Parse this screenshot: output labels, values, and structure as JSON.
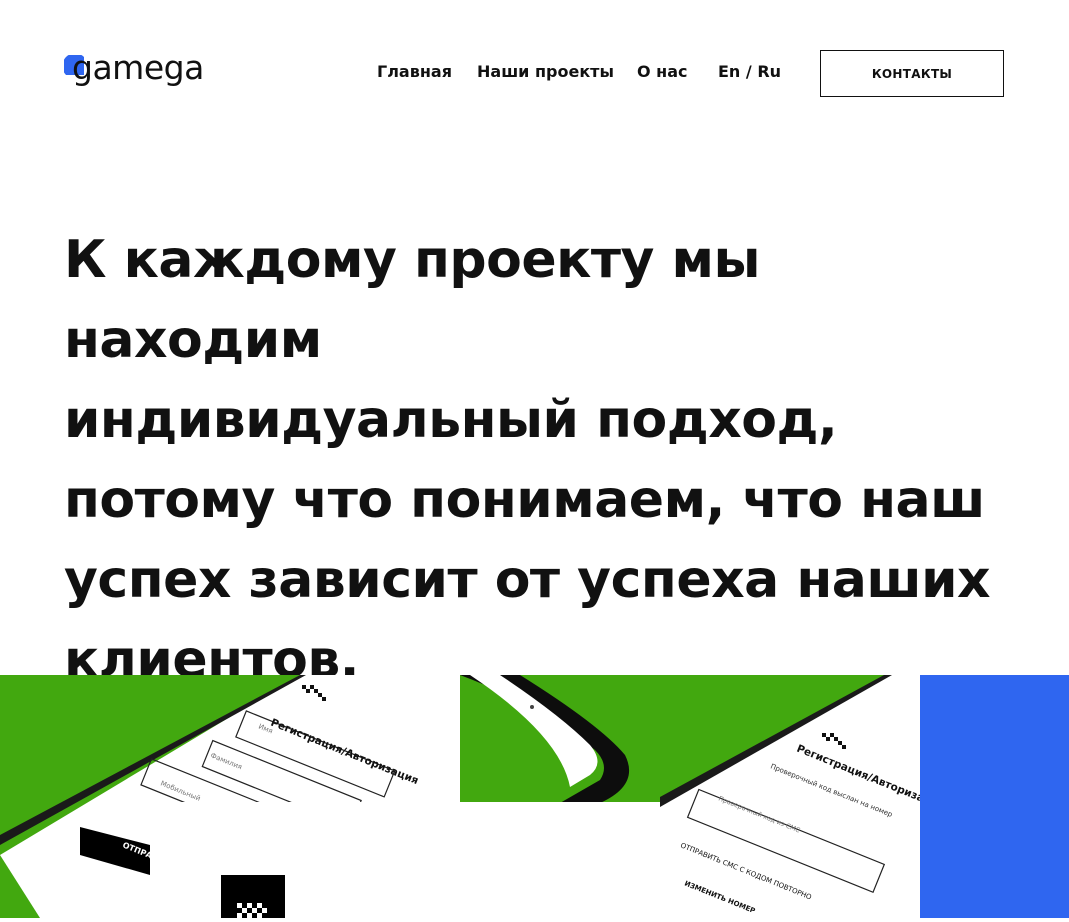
{
  "header": {
    "logo_text": "gamega",
    "nav": [
      {
        "label": "Главная"
      },
      {
        "label": "Наши проекты"
      },
      {
        "label": "О нас"
      }
    ],
    "lang_en": "En",
    "lang_sep": "/",
    "lang_ru": "Ru",
    "contacts_label": "КОНТАКТЫ"
  },
  "hero": {
    "lines": [
      "К каждому проекту мы находим",
      "индивидуальный подход,",
      "потому что понимаем, что наш",
      "успех зависит от успеха наших",
      "клиентов."
    ]
  },
  "gallery": {
    "left_screen": {
      "title": "Регистрация/Авторизация",
      "field_1": "Имя",
      "field_2": "Фамилия",
      "field_3": "Мобильный",
      "button": "ОТПРАВИТЬ"
    },
    "right_screen": {
      "title": "Регистрация/Авторизация",
      "sms_note": "Проверочный код выслан на номер",
      "code_placeholder": "Проверочный код из СМС",
      "resend": "ОТПРАВИТЬ СМС С КОДОМ ПОВТОРНО",
      "change_number": "ИЗМЕНИТЬ НОМЕР"
    },
    "colors": {
      "green": "#42a80f",
      "blue": "#2f66f0",
      "black": "#111111"
    }
  }
}
